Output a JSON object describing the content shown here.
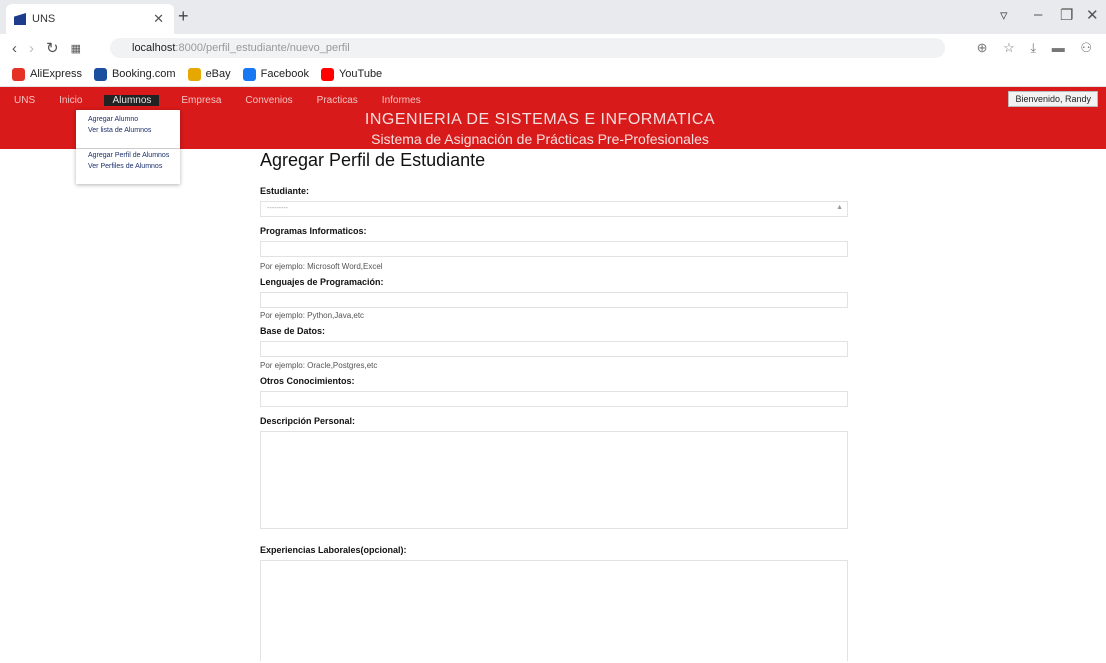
{
  "browser": {
    "tab_title": "UNS",
    "url_host": "localhost",
    "url_path": ":8000/perfil_estudiante/nuevo_perfil",
    "bookmarks": [
      {
        "label": "AliExpress",
        "color": "#e43225"
      },
      {
        "label": "Booking.com",
        "color": "#1a4fa0"
      },
      {
        "label": "eBay",
        "color": "#e6a700"
      },
      {
        "label": "Facebook",
        "color": "#1877f2"
      },
      {
        "label": "YouTube",
        "color": "#ff0000"
      }
    ]
  },
  "app": {
    "nav": [
      "UNS",
      "Inicio",
      "Alumnos",
      "Empresa",
      "Convenios",
      "Practicas",
      "Informes"
    ],
    "active_nav": "Alumnos",
    "title": "INGENIERIA DE SISTEMAS E INFORMATICA",
    "subtitle": "Sistema de Asignación de Prácticas Pre-Profesionales",
    "user_button": "Bienvenido, Randy",
    "accent": "#d81a1a"
  },
  "dropdown": {
    "items": [
      "Agregar Alumno",
      "Ver lista de Alumnos",
      "Agregar Perfil de Alumnos",
      "Ver Perfiles de Alumnos"
    ]
  },
  "form": {
    "heading": "Agregar Perfil de Estudiante",
    "estudiante_label": "Estudiante:",
    "estudiante_value": "---------",
    "programas_label": "Programas Informaticos:",
    "programas_hint": "Por ejemplo: Microsoft Word,Excel",
    "lenguajes_label": "Lenguajes de Programación:",
    "lenguajes_hint": "Por ejemplo: Python,Java,etc",
    "bd_label": "Base de Datos:",
    "bd_hint": "Por ejemplo: Oracle,Postgres,etc",
    "otros_label": "Otros Conocimientos:",
    "descripcion_label": "Descripción Personal:",
    "experiencias_label": "Experiencias Laborales(opcional):"
  }
}
